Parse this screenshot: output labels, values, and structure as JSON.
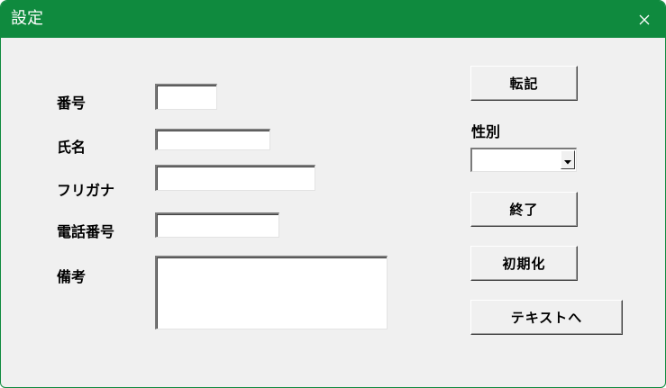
{
  "window": {
    "title": "設定",
    "close_glyph": "✕",
    "accent_color": "#0f8a3e",
    "background_color": "#f0f0f0"
  },
  "form": {
    "labels": {
      "number": "番号",
      "name": "氏名",
      "furigana": "フリガナ",
      "phone": "電話番号",
      "notes": "備考",
      "gender": "性別"
    },
    "values": {
      "number": "",
      "name": "",
      "furigana": "",
      "phone": "",
      "notes": "",
      "gender": ""
    }
  },
  "buttons": {
    "transfer": "転記",
    "exit": "終了",
    "reset": "初期化",
    "to_text": "テキストへ"
  },
  "icons": {
    "close": "close-icon",
    "dropdown": "chevron-down-icon"
  }
}
